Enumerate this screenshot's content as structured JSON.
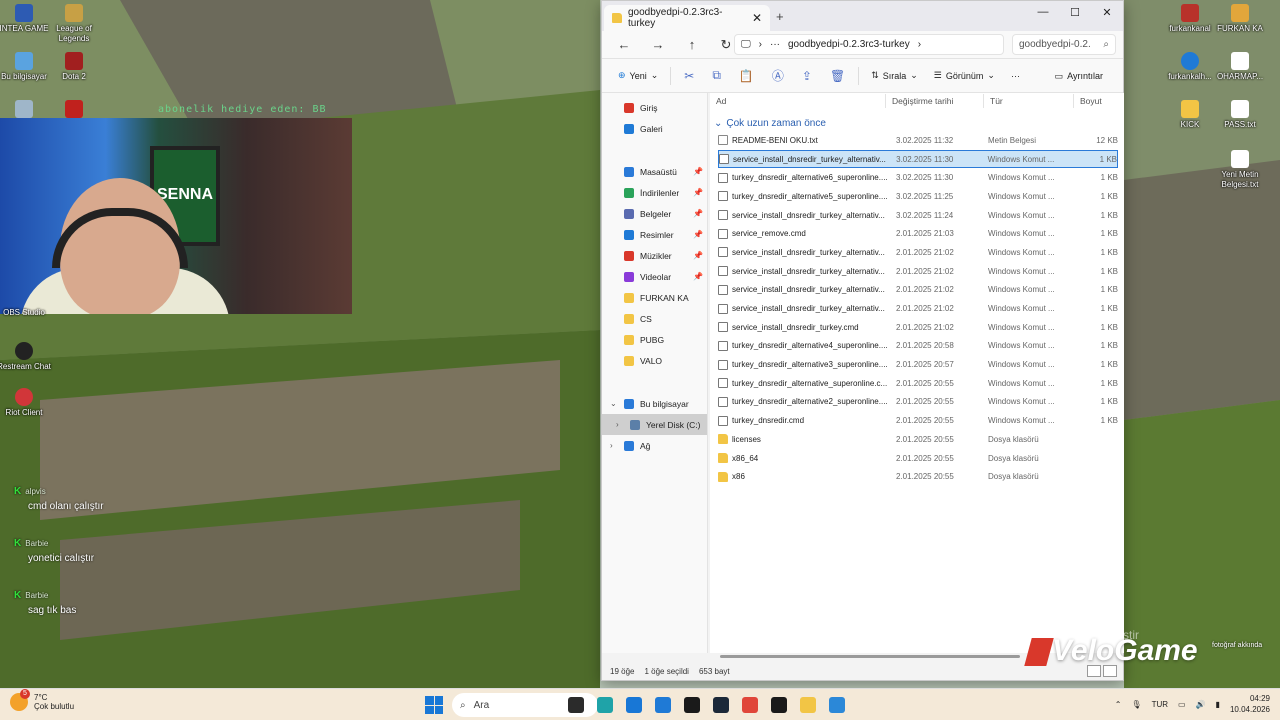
{
  "desktop": {
    "left_icons": [
      {
        "label": "INTEA GAME",
        "color": "#2d5bb3"
      },
      {
        "label": "League of Legends",
        "color": "#c7a045"
      },
      {
        "label": "Bu bilgisayar",
        "color": "#5aa3e0"
      },
      {
        "label": "Dota 2",
        "color": "#a11f1f"
      },
      {
        "label": "OBS Studio",
        "color": "#333333"
      },
      {
        "label": "Restream Chat",
        "color": "#222222"
      },
      {
        "label": "Riot Client",
        "color": "#d13639"
      }
    ],
    "right_icons": [
      {
        "label": "furkankanal",
        "color": "#b8322a"
      },
      {
        "label": "FURKAN KA",
        "color": "#e2a63b"
      },
      {
        "label": "furkankalh...",
        "color": "#1f7ad6"
      },
      {
        "label": "OHARMAP...",
        "color": "#ffffff"
      },
      {
        "label": "KICK",
        "color": "#f2c545"
      },
      {
        "label": "PASS.txt",
        "color": "#ffffff"
      },
      {
        "label": "Yeni Metin Belgesi.txt",
        "color": "#ffffff"
      }
    ],
    "ticker": "abonelik hediye eden: BB",
    "watermark_line1": "Windows'u Etkinleştir",
    "brand": "VeloGame",
    "corner_note": "fotoğraf akkında"
  },
  "chat": [
    {
      "user": "alpvis",
      "message": "cmd olanı çalıştır"
    },
    {
      "user": "Barbie",
      "message": "yonetici calıştır"
    },
    {
      "user": "Barbie",
      "message": "sag tık bas"
    }
  ],
  "window": {
    "tab_title": "goodbyedpi-0.2.3rc3-turkey",
    "controls": {
      "minimize": "—",
      "maximize": "☐",
      "close": "✕"
    },
    "address": {
      "path": "goodbyedpi-0.2.3rc3-turkey",
      "more": "···"
    },
    "search_placeholder": "goodbyedpi-0.2.",
    "toolbar": {
      "new": "Yeni",
      "sort": "Sırala",
      "view": "Görünüm",
      "more": "···",
      "details": "Ayrıntılar"
    },
    "nav": {
      "quick": [
        {
          "label": "Giriş",
          "color": "#d9382b"
        },
        {
          "label": "Galeri",
          "color": "#1f7ad6"
        }
      ],
      "pinned": [
        {
          "label": "Masaüstü",
          "color": "#2a7ad8"
        },
        {
          "label": "İndirilenler",
          "color": "#2aa35a"
        },
        {
          "label": "Belgeler",
          "color": "#5a6bb0"
        },
        {
          "label": "Resimler",
          "color": "#1f7ad6"
        },
        {
          "label": "Müzikler",
          "color": "#d9382b"
        },
        {
          "label": "Videolar",
          "color": "#8a3bd9"
        }
      ],
      "folders": [
        {
          "label": "FURKAN KA",
          "color": "#f2c545"
        },
        {
          "label": "CS",
          "color": "#f2c545"
        },
        {
          "label": "PUBG",
          "color": "#f2c545"
        },
        {
          "label": "VALO",
          "color": "#f2c545"
        }
      ],
      "this_pc": "Bu bilgisayar",
      "drive": "Yerel Disk (C:)",
      "network": "Ağ"
    },
    "columns": {
      "name": "Ad",
      "modified": "Değiştirme tarihi",
      "type": "Tür",
      "size": "Boyut"
    },
    "group": "Çok uzun zaman önce",
    "files": [
      {
        "name": "README-BENI OKU.txt",
        "date": "3.02.2025 11:32",
        "type": "Metin Belgesi",
        "size": "12 KB",
        "kind": "txt"
      },
      {
        "name": "service_install_dnsredir_turkey_alternativ...",
        "date": "3.02.2025 11:30",
        "type": "Windows Komut ...",
        "size": "1 KB",
        "kind": "cmd",
        "selected": true
      },
      {
        "name": "turkey_dnsredir_alternative6_superonline....",
        "date": "3.02.2025 11:30",
        "type": "Windows Komut ...",
        "size": "1 KB",
        "kind": "cmd"
      },
      {
        "name": "turkey_dnsredir_alternative5_superonline....",
        "date": "3.02.2025 11:25",
        "type": "Windows Komut ...",
        "size": "1 KB",
        "kind": "cmd"
      },
      {
        "name": "service_install_dnsredir_turkey_alternativ...",
        "date": "3.02.2025 11:24",
        "type": "Windows Komut ...",
        "size": "1 KB",
        "kind": "cmd"
      },
      {
        "name": "service_remove.cmd",
        "date": "2.01.2025 21:03",
        "type": "Windows Komut ...",
        "size": "1 KB",
        "kind": "cmd"
      },
      {
        "name": "service_install_dnsredir_turkey_alternativ...",
        "date": "2.01.2025 21:02",
        "type": "Windows Komut ...",
        "size": "1 KB",
        "kind": "cmd"
      },
      {
        "name": "service_install_dnsredir_turkey_alternativ...",
        "date": "2.01.2025 21:02",
        "type": "Windows Komut ...",
        "size": "1 KB",
        "kind": "cmd"
      },
      {
        "name": "service_install_dnsredir_turkey_alternativ...",
        "date": "2.01.2025 21:02",
        "type": "Windows Komut ...",
        "size": "1 KB",
        "kind": "cmd"
      },
      {
        "name": "service_install_dnsredir_turkey_alternativ...",
        "date": "2.01.2025 21:02",
        "type": "Windows Komut ...",
        "size": "1 KB",
        "kind": "cmd"
      },
      {
        "name": "service_install_dnsredir_turkey.cmd",
        "date": "2.01.2025 21:02",
        "type": "Windows Komut ...",
        "size": "1 KB",
        "kind": "cmd"
      },
      {
        "name": "turkey_dnsredir_alternative4_superonline....",
        "date": "2.01.2025 20:58",
        "type": "Windows Komut ...",
        "size": "1 KB",
        "kind": "cmd"
      },
      {
        "name": "turkey_dnsredir_alternative3_superonline....",
        "date": "2.01.2025 20:57",
        "type": "Windows Komut ...",
        "size": "1 KB",
        "kind": "cmd"
      },
      {
        "name": "turkey_dnsredir_alternative_superonline.c...",
        "date": "2.01.2025 20:55",
        "type": "Windows Komut ...",
        "size": "1 KB",
        "kind": "cmd"
      },
      {
        "name": "turkey_dnsredir_alternative2_superonline....",
        "date": "2.01.2025 20:55",
        "type": "Windows Komut ...",
        "size": "1 KB",
        "kind": "cmd"
      },
      {
        "name": "turkey_dnsredir.cmd",
        "date": "2.01.2025 20:55",
        "type": "Windows Komut ...",
        "size": "1 KB",
        "kind": "cmd"
      },
      {
        "name": "licenses",
        "date": "2.01.2025 20:55",
        "type": "Dosya klasörü",
        "size": "",
        "kind": "folder"
      },
      {
        "name": "x86_64",
        "date": "2.01.2025 20:55",
        "type": "Dosya klasörü",
        "size": "",
        "kind": "folder"
      },
      {
        "name": "x86",
        "date": "2.01.2025 20:55",
        "type": "Dosya klasörü",
        "size": "",
        "kind": "folder"
      }
    ],
    "status": {
      "count": "19 öğe",
      "selected": "1 öğe seçildi",
      "size": "653 bayt"
    }
  },
  "taskbar": {
    "weather_temp": "7°C",
    "weather_desc": "Çok bulutlu",
    "weather_badge": "5",
    "search": "Ara",
    "apps": [
      "#2b2b2b",
      "#1fa3a8",
      "#1877d6",
      "#1f7ad6",
      "#1a1a1a",
      "#1b2838",
      "#e0463a",
      "#1a1a1a",
      "#f2c545",
      "#2b88d8"
    ],
    "lang": "TUR",
    "time": "04:29",
    "date": "10.04.2026"
  }
}
